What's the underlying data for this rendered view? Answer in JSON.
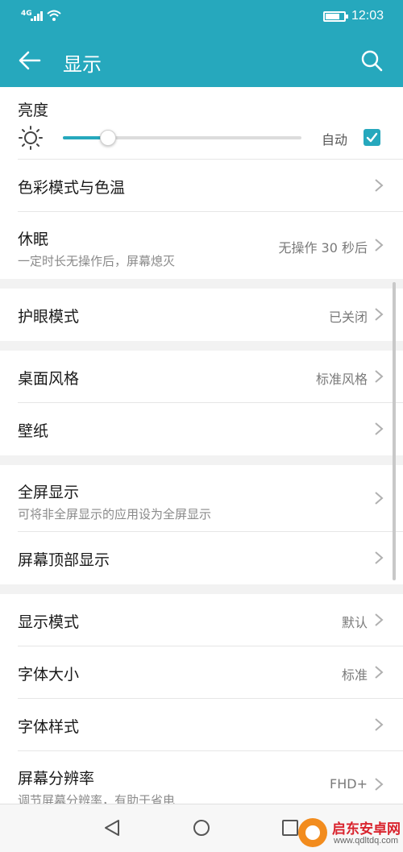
{
  "status_bar": {
    "signal": "4G",
    "time": "12:03",
    "battery_level_percent": 80,
    "icons": [
      "signal-icon",
      "wifi-icon",
      "battery-icon"
    ]
  },
  "header": {
    "title": "显示",
    "back_icon": "arrow-left-icon",
    "search_icon": "search-icon",
    "color": "#26a8bd"
  },
  "brightness": {
    "title": "亮度",
    "icon": "sun-icon",
    "level_percent": 19,
    "auto_label": "自动",
    "auto_checked": true
  },
  "groups": [
    [
      {
        "title": "色彩模式与色温",
        "sub": "",
        "value": ""
      },
      {
        "title": "休眠",
        "sub": "一定时长无操作后，屏幕熄灭",
        "value": "无操作 30 秒后"
      }
    ],
    [
      {
        "title": "护眼模式",
        "sub": "",
        "value": "已关闭"
      }
    ],
    [
      {
        "title": "桌面风格",
        "sub": "",
        "value": "标准风格"
      },
      {
        "title": "壁纸",
        "sub": "",
        "value": ""
      }
    ],
    [
      {
        "title": "全屏显示",
        "sub": "可将非全屏显示的应用设为全屏显示",
        "value": ""
      },
      {
        "title": "屏幕顶部显示",
        "sub": "",
        "value": ""
      }
    ],
    [
      {
        "title": "显示模式",
        "sub": "",
        "value": "默认"
      },
      {
        "title": "字体大小",
        "sub": "",
        "value": "标准"
      },
      {
        "title": "字体样式",
        "sub": "",
        "value": ""
      },
      {
        "title": "屏幕分辨率",
        "sub": "调节屏幕分辨率，有助于省电",
        "value": "FHD+"
      }
    ]
  ],
  "nav": {
    "icons": [
      "nav-back-icon",
      "nav-home-icon",
      "nav-recent-icon"
    ]
  },
  "watermark": {
    "name": "启东安卓网",
    "url": "www.qdltdq.com"
  }
}
